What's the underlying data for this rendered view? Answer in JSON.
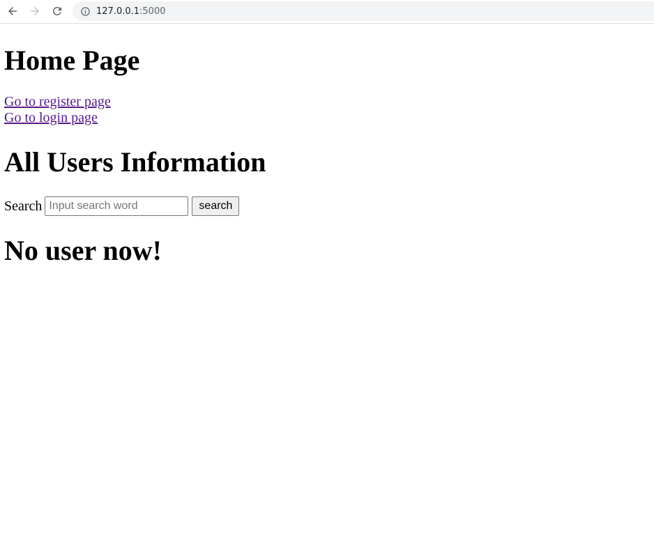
{
  "browser": {
    "url_host": "127.0.0.1",
    "url_port": ":5000"
  },
  "page": {
    "home_title": "Home Page",
    "register_link": "Go to register page",
    "login_link": "Go to login page",
    "users_title": "All Users Information",
    "search_label": "Search",
    "search_placeholder": "Input search word",
    "search_value": "",
    "search_button": "search",
    "empty_message": "No user now!"
  },
  "colors": {
    "link_visited": "#551a8b",
    "address_bar_bg": "#f1f3f4"
  }
}
